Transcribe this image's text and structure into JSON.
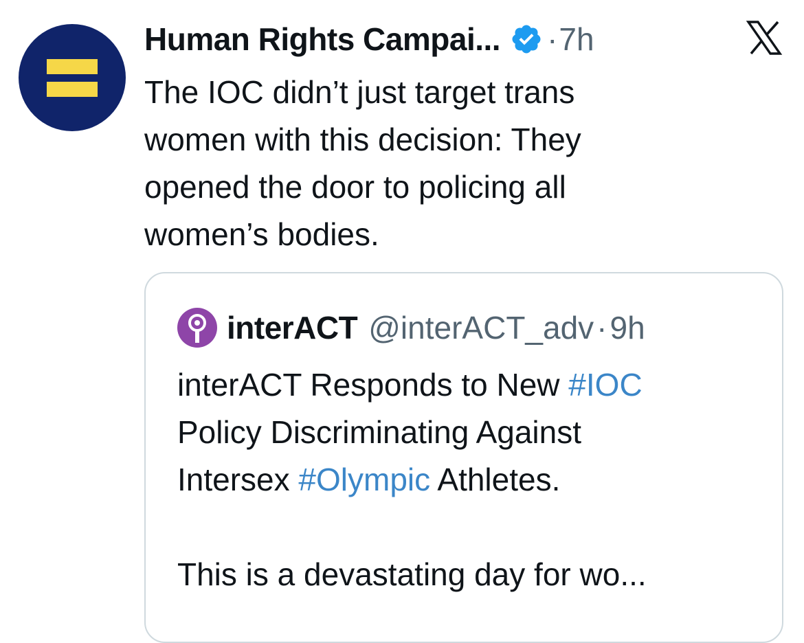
{
  "post": {
    "author": "Human Rights Campai...",
    "time_separator": "·",
    "time": "7h",
    "body_lines": [
      "The IOC didn’t just target trans",
      "women with this decision: They",
      "opened the door to policing all",
      "women’s bodies."
    ]
  },
  "platform_logo": "X",
  "quote": {
    "name": "interACT",
    "handle": "@interACT_adv",
    "separator": "·",
    "time": "9h",
    "line1_before": "interACT Responds to New ",
    "hashtag1": "#IOC",
    "line2": "Policy Discriminating Against",
    "line3_before": "Intersex ",
    "hashtag2": "#Olympic",
    "line3_after": " Athletes.",
    "line4": "This is a devastating day for wo..."
  },
  "colors": {
    "avatar_bg": "#10246a",
    "avatar_bars": "#f6d748",
    "verified": "#1d9bf0",
    "hashtag": "#3b86c8",
    "quote_avatar": "#8e45a8",
    "muted_text": "#536471"
  },
  "icons": {
    "verified": "verified-badge-icon",
    "close": "x-logo-icon"
  }
}
